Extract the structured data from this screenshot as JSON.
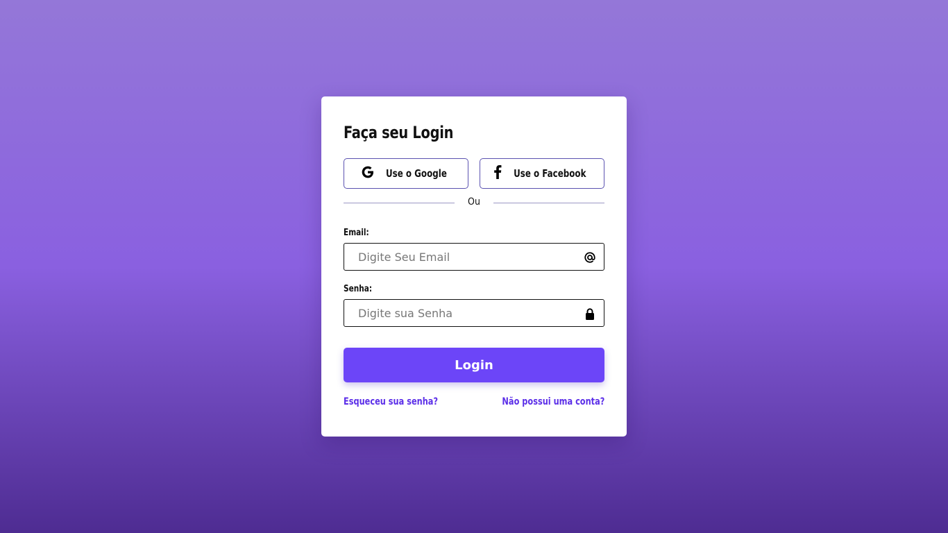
{
  "login_card": {
    "title": "Faça seu Login",
    "social": {
      "google_label": "Use o Google",
      "facebook_label": "Use o Facebook"
    },
    "divider_text": "Ou",
    "email": {
      "label": "Email:",
      "placeholder": "Digite Seu Email",
      "value": "",
      "icon": "at-sign-icon"
    },
    "password": {
      "label": "Senha:",
      "placeholder": "Digite sua Senha",
      "value": "",
      "icon": "lock-icon"
    },
    "submit_label": "Login",
    "forgot_password_link": "Esqueceu sua senha?",
    "signup_link": "Não possui uma conta?"
  },
  "colors": {
    "accent": "#6c45f8",
    "link": "#5b2ee8",
    "background_top": "#9477d8",
    "background_bottom": "#4e2c92"
  }
}
